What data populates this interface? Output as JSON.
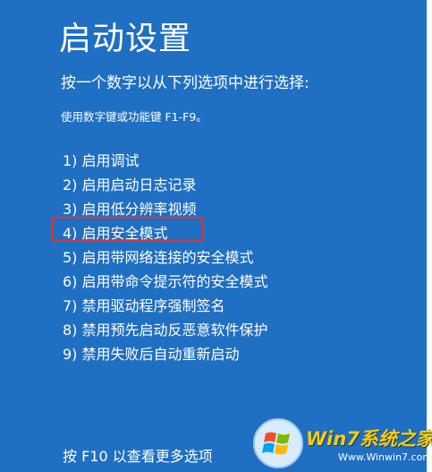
{
  "screen": {
    "title": "启动设置",
    "instruction": "按一个数字以从下列选项中进行选择:",
    "hint": "使用数字键或功能键 F1-F9。",
    "options": [
      "1) 启用调试",
      "2) 启用启动日志记录",
      "3) 启用低分辨率视频",
      "4) 启用安全模式",
      "5) 启用带网络连接的安全模式",
      "6) 启用带命令提示符的安全模式",
      "7) 禁用驱动程序强制签名",
      "8) 禁用预先启动反恶意软件保护",
      "9) 禁用失败后自动重新启动"
    ],
    "highlighted_option": "4) 启用安全模式",
    "footer": "按 F10 以查看更多选项"
  },
  "watermark": {
    "brand": "Win7系统之家",
    "url": "Www.Winwin7.com"
  },
  "colors": {
    "background": "#1f6fc2",
    "highlight_border": "#e53232",
    "brand_accent": "#ffcc00"
  }
}
